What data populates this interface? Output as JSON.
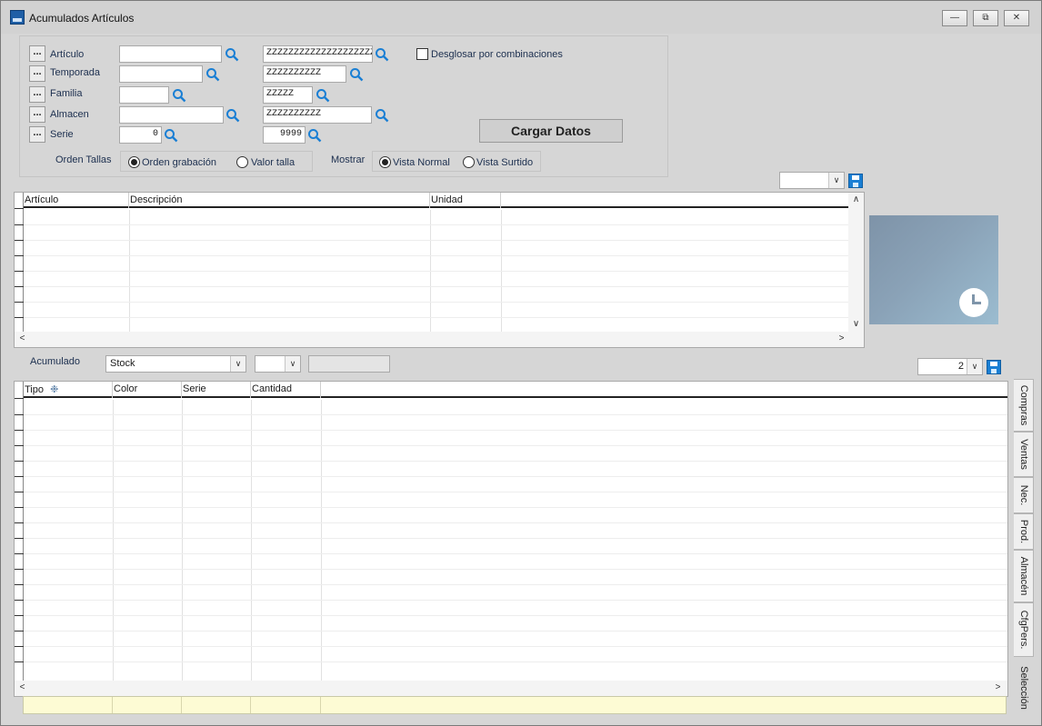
{
  "window": {
    "title": "Acumulados Artículos",
    "icon": "app-icon",
    "controls": [
      "minimize-icon",
      "restore-icon",
      "close-icon"
    ]
  },
  "filters": {
    "rows": [
      {
        "label": "Artículo",
        "from": "",
        "to": "ZZZZZZZZZZZZZZZZZZZZ"
      },
      {
        "label": "Temporada",
        "from": "",
        "to": "ZZZZZZZZZZ"
      },
      {
        "label": "Familia",
        "from": "",
        "to": "ZZZZZ"
      },
      {
        "label": "Almacen",
        "from": "",
        "to": "ZZZZZZZZZZ"
      },
      {
        "label": "Serie",
        "from": "0",
        "to": "9999"
      }
    ],
    "dots_label": "...",
    "desglosar_label": "Desglosar por combinaciones",
    "desglosar_checked": false,
    "load_button": "Cargar Datos",
    "orden_tallas": {
      "title": "Orden Tallas",
      "options": [
        "Orden grabación",
        "Valor talla"
      ],
      "selected": "Orden grabación"
    },
    "mostrar": {
      "title": "Mostrar",
      "options": [
        "Vista Normal",
        "Vista Surtido"
      ],
      "selected": "Vista Normal"
    }
  },
  "top_grid": {
    "columns": [
      "Artículo",
      "Descripción",
      "Unidad"
    ],
    "rows": [],
    "selector_value": ""
  },
  "acumulado": {
    "label": "Acumulado",
    "selected": "Stock",
    "second_selected": "",
    "text": ""
  },
  "bottom_grid": {
    "columns": [
      "Tipo",
      "Color",
      "Serie",
      "Cantidad"
    ],
    "rows": [],
    "selector_value": "2"
  },
  "side_tabs": [
    "Compras",
    "Ventas",
    "Nec.",
    "Prod.",
    "Almacén",
    "CfgPers.",
    "Selección"
  ],
  "side_tab_active": "Selección",
  "colors": {
    "accent": "#1a7fd4",
    "window_bg": "#d6d6d6",
    "totals_bg": "#fdfbd4"
  }
}
